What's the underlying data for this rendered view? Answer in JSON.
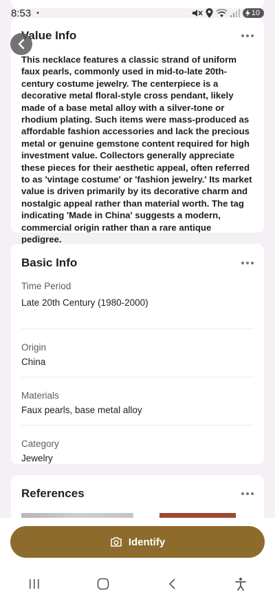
{
  "status_bar": {
    "time": "8:53",
    "dot": "•",
    "battery": "10"
  },
  "value_info": {
    "title": "Value Info",
    "text": "This necklace features a classic strand of uniform faux pearls, commonly used in mid-to-late 20th-century costume jewelry. The centerpiece is a decorative metal floral-style cross pendant, likely made of a base metal alloy with a silver-tone or rhodium plating. Such items were mass-produced as affordable fashion accessories and lack the precious metal or genuine gemstone content required for high investment value. Collectors generally appreciate these pieces for their aesthetic appeal, often referred to as 'vintage costume' or 'fashion jewelry.' Its market value is driven primarily by its decorative charm and nostalgic appeal rather than material worth. The tag indicating 'Made in China' suggests a modern, commercial origin rather than a rare antique pedigree."
  },
  "basic_info": {
    "title": "Basic Info",
    "rows": [
      {
        "label": "Time Period",
        "value": "Late 20th Century (1980-2000)"
      },
      {
        "label": "Origin",
        "value": "China"
      },
      {
        "label": "Materials",
        "value": "Faux pearls, base metal alloy"
      },
      {
        "label": "Category",
        "value": "Jewelry"
      }
    ]
  },
  "references": {
    "title": "References"
  },
  "identify_button": {
    "label": "Identify"
  },
  "icons": {
    "back": "chevron-left-icon",
    "more": "more-horizontal-icon",
    "camera": "camera-icon",
    "nav_recents": "recents-icon",
    "nav_home": "home-icon",
    "nav_back": "back-icon",
    "accessibility": "accessibility-icon"
  },
  "colors": {
    "background": "#f5f0f5",
    "card": "#ffffff",
    "accent": "#8c6b2c"
  }
}
